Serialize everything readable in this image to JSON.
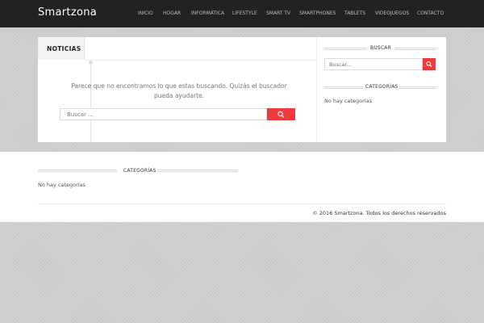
{
  "header": {
    "brand": "Smartzona",
    "nav": [
      "INICIO",
      "HOGAR",
      "INFORMÁTICA",
      "LIFESTYLE",
      "SMART TV",
      "SMARTPHONES",
      "TABLETS",
      "VIDEOJUEGOS",
      "CONTACTO"
    ]
  },
  "main": {
    "tab_label": "NOTICIAS",
    "not_found_text": "Parece que no encontramos lo que estas buscando. Quizás el buscador pueda ayudarte.",
    "search_placeholder": "Buscar ...",
    "search_icon": "search-icon"
  },
  "sidebar": {
    "search_title": "BUSCAR",
    "search_placeholder": "Buscar...",
    "categories_title": "CATEGORÍAS",
    "categories_empty": "No hay categorías"
  },
  "footer": {
    "categories_title": "CATEGORÍAS",
    "categories_empty": "No hay categorías",
    "copyright": "© 2016 Smartzona. Todos los derechos reservados"
  },
  "colors": {
    "accent": "#ef3b3b",
    "topbar": "#222222",
    "page_background": "#cfcfcf"
  }
}
